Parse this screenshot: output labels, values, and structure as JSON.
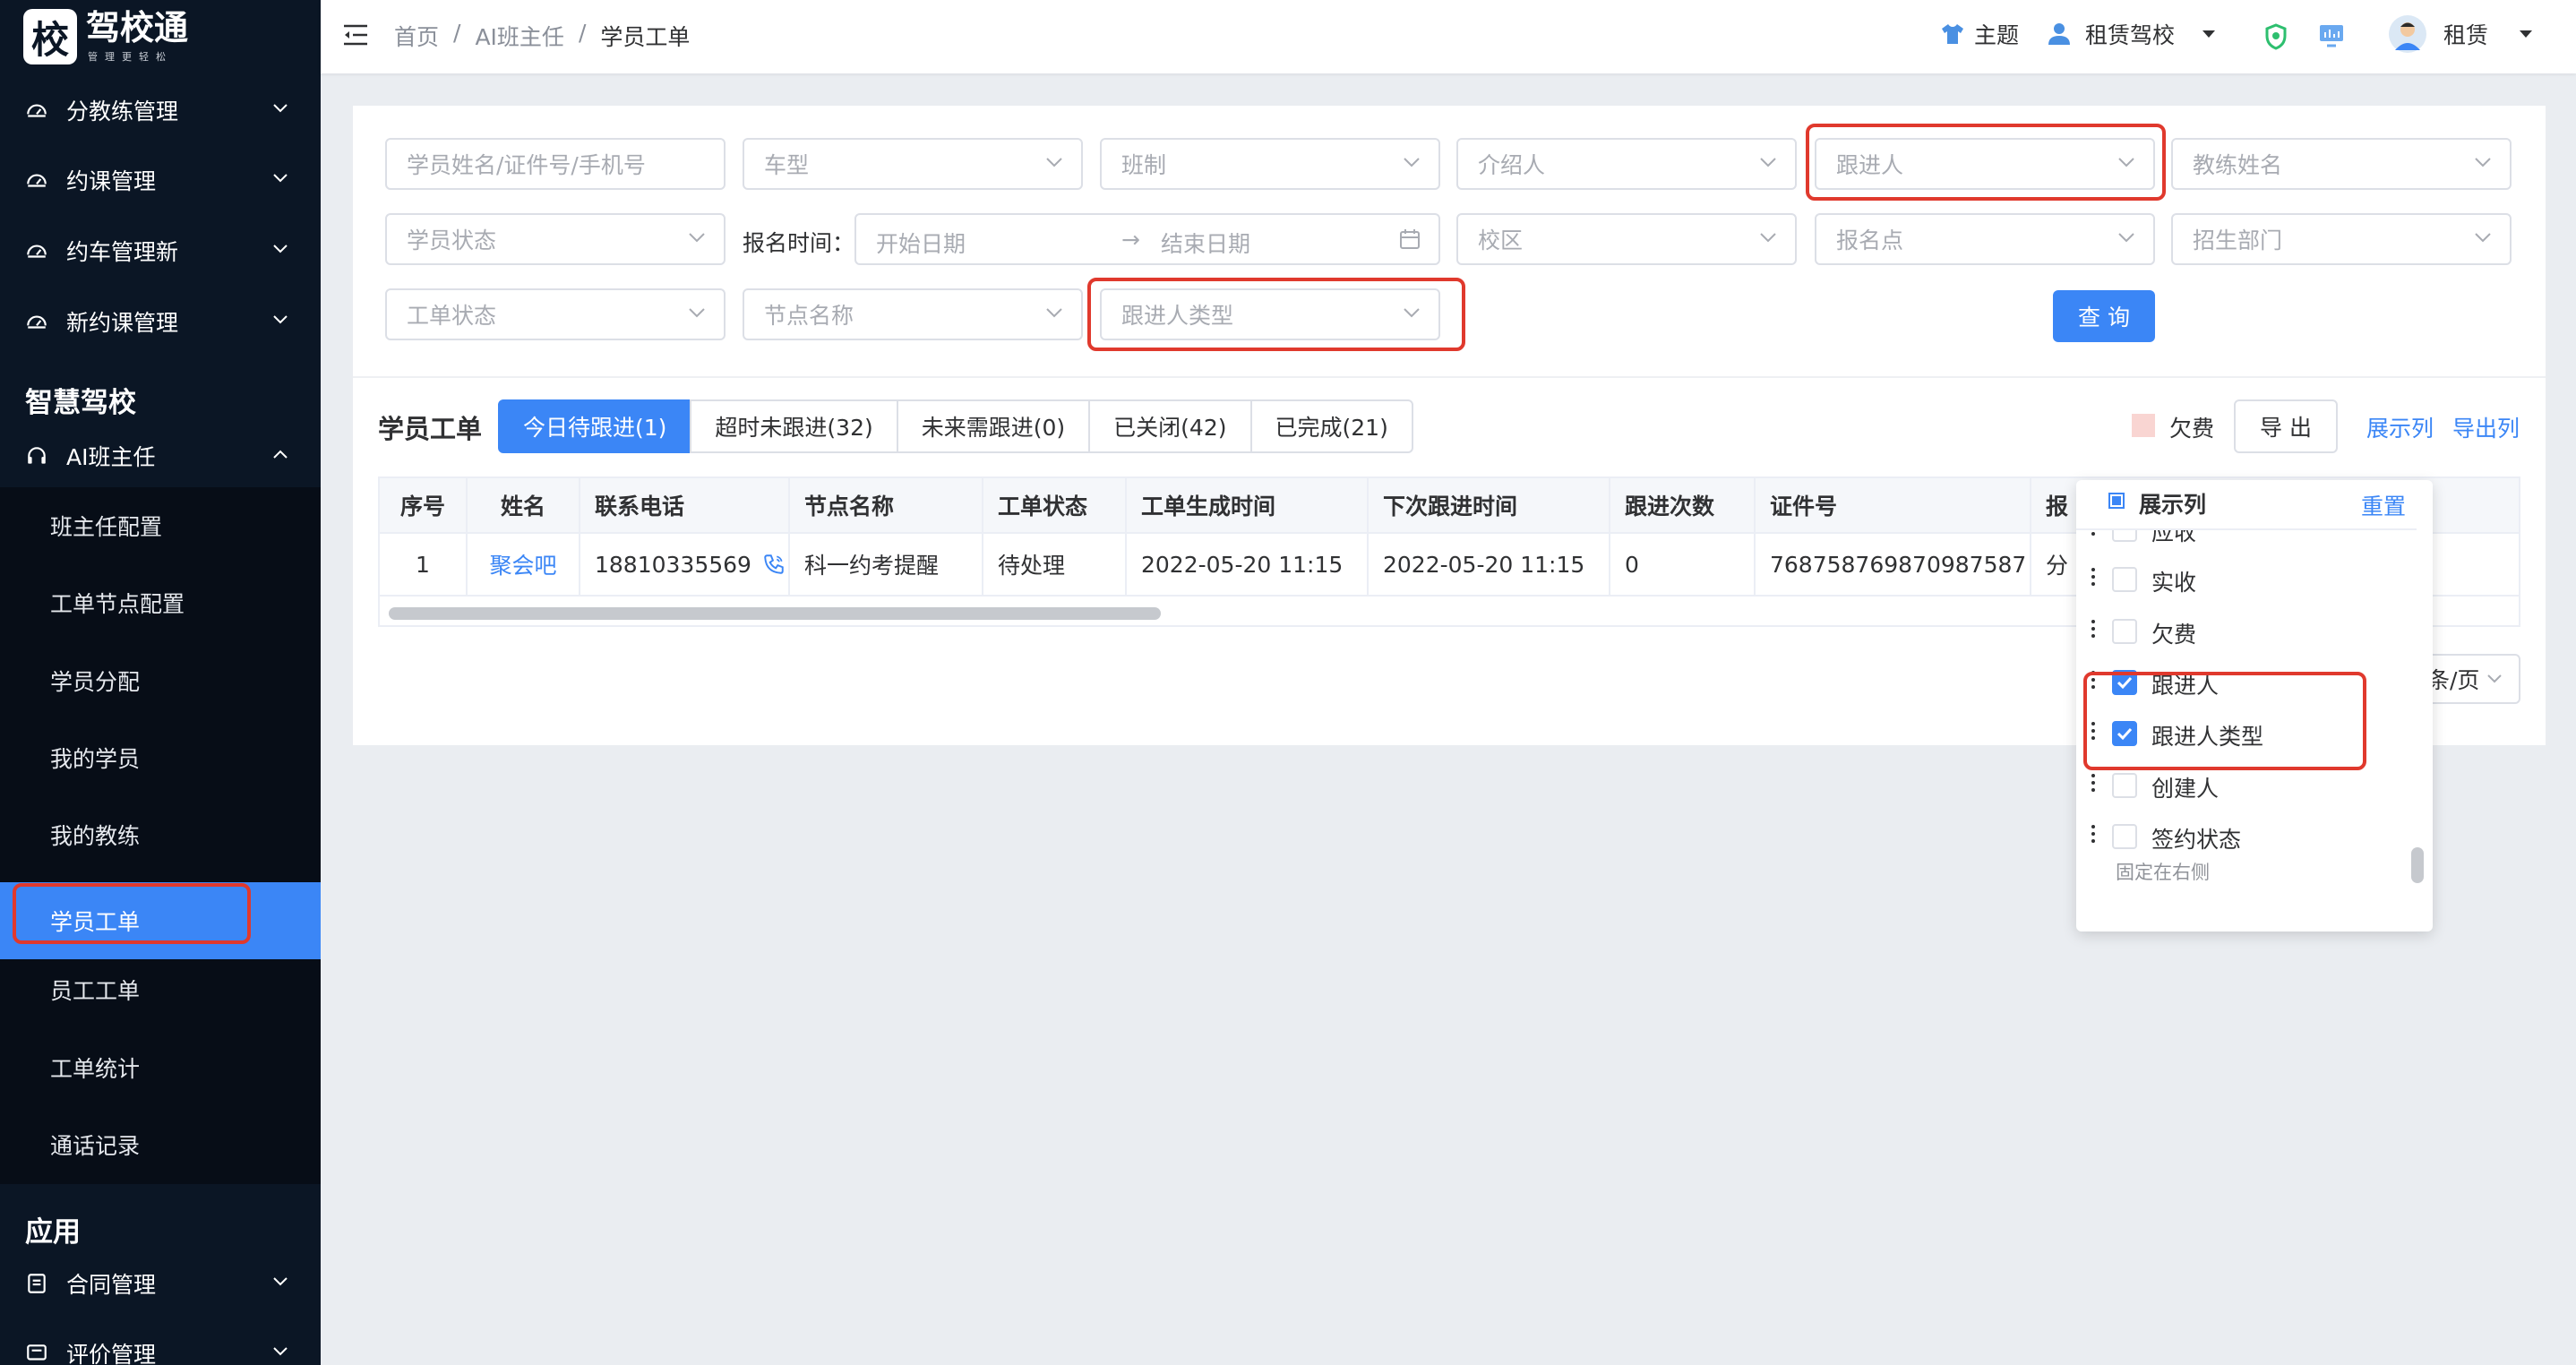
{
  "logo": {
    "main": "驾校通",
    "sub": "管理更轻松",
    "glyph": "校"
  },
  "breadcrumb": [
    "首页",
    "AI班主任",
    "学员工单"
  ],
  "header": {
    "theme_label": "主题",
    "school": "租赁驾校",
    "user": "租赁"
  },
  "sidebar": {
    "groups_top": [
      {
        "label": "分教练管理"
      },
      {
        "label": "约课管理"
      },
      {
        "label": "约车管理新"
      },
      {
        "label": "新约课管理"
      }
    ],
    "section1": "智慧驾校",
    "ai_group": "AI班主任",
    "sub_items": [
      {
        "label": "班主任配置",
        "active": false,
        "box": false
      },
      {
        "label": "工单节点配置",
        "active": false,
        "box": false
      },
      {
        "label": "学员分配",
        "active": false,
        "box": false
      },
      {
        "label": "我的学员",
        "active": false,
        "box": false
      },
      {
        "label": "我的教练",
        "active": false,
        "box": false
      },
      {
        "label": "学员工单",
        "active": true,
        "box": true
      },
      {
        "label": "员工工单",
        "active": false,
        "box": false
      },
      {
        "label": "工单统计",
        "active": false,
        "box": false
      },
      {
        "label": "通话记录",
        "active": false,
        "box": false
      }
    ],
    "section2": "应用",
    "groups_bottom": [
      {
        "label": "合同管理"
      },
      {
        "label": "评价管理"
      }
    ]
  },
  "filters": {
    "row1": [
      {
        "placeholder": "学员姓名/证件号/手机号",
        "dropdown": false,
        "boxed": false
      },
      {
        "placeholder": "车型",
        "dropdown": true,
        "boxed": false
      },
      {
        "placeholder": "班制",
        "dropdown": true,
        "boxed": false
      },
      {
        "placeholder": "介绍人",
        "dropdown": true,
        "boxed": false
      },
      {
        "placeholder": "跟进人",
        "dropdown": true,
        "boxed": true
      },
      {
        "placeholder": "教练姓名",
        "dropdown": true,
        "boxed": false
      }
    ],
    "status": "学员状态",
    "date_label": "报名时间：",
    "date_start": "开始日期",
    "date_arrow": "→",
    "date_end": "结束日期",
    "row2_rest": [
      {
        "placeholder": "校区"
      },
      {
        "placeholder": "报名点"
      },
      {
        "placeholder": "招生部门"
      }
    ],
    "row3": [
      {
        "placeholder": "工单状态",
        "boxed": false
      },
      {
        "placeholder": "节点名称",
        "boxed": false
      },
      {
        "placeholder": "跟进人类型",
        "boxed": true
      }
    ],
    "query_button": "查 询"
  },
  "list": {
    "title": "学员工单",
    "tabs": [
      {
        "label": "今日待跟进(1)",
        "active": true
      },
      {
        "label": "超时未跟进(32)",
        "active": false
      },
      {
        "label": "未来需跟进(0)",
        "active": false
      },
      {
        "label": "已关闭(42)",
        "active": false
      },
      {
        "label": "已完成(21)",
        "active": false
      }
    ],
    "arrears_legend": "欠费",
    "export_button": "导 出",
    "show_columns": "展示列",
    "export_columns": "导出列",
    "page_size_fragment": "条/页"
  },
  "table": {
    "columns": [
      "序号",
      "姓名",
      "联系电话",
      "节点名称",
      "工单状态",
      "工单生成时间",
      "下次跟进时间",
      "跟进次数",
      "证件号",
      "报"
    ],
    "rows": [
      {
        "no": "1",
        "name": "聚会吧",
        "phone": "18810335569",
        "node": "科一约考提醒",
        "status": "待处理",
        "created": "2022-05-20 11:15",
        "next": "2022-05-20 11:15",
        "count": "0",
        "id": "768758769870987587",
        "extra": "分"
      }
    ]
  },
  "column_popup": {
    "header": "展示列",
    "reset": "重置",
    "items": [
      {
        "label": "应收",
        "checked": false,
        "boxed": false
      },
      {
        "label": "实收",
        "checked": false,
        "boxed": false
      },
      {
        "label": "欠费",
        "checked": false,
        "boxed": false
      },
      {
        "label": "跟进人",
        "checked": true,
        "boxed": true
      },
      {
        "label": "跟进人类型",
        "checked": true,
        "boxed": true
      },
      {
        "label": "创建人",
        "checked": false,
        "boxed": false
      },
      {
        "label": "签约状态",
        "checked": false,
        "boxed": false
      }
    ],
    "footer": "固定在右侧"
  },
  "colors": {
    "sidebar_bg": "#0b1625",
    "accent": "#3b86f6",
    "highlight_red": "#e0392d",
    "arrears_swatch": "#f9d5d2"
  },
  "icons": {
    "collapse": "menu-fold-icon",
    "theme": "tshirt-icon",
    "school": "people-icon",
    "shield": "shield-icon",
    "chart": "monitor-chart-icon",
    "avatar": "user-avatar-icon",
    "phone": "phone-icon",
    "calendar": "calendar-icon"
  }
}
